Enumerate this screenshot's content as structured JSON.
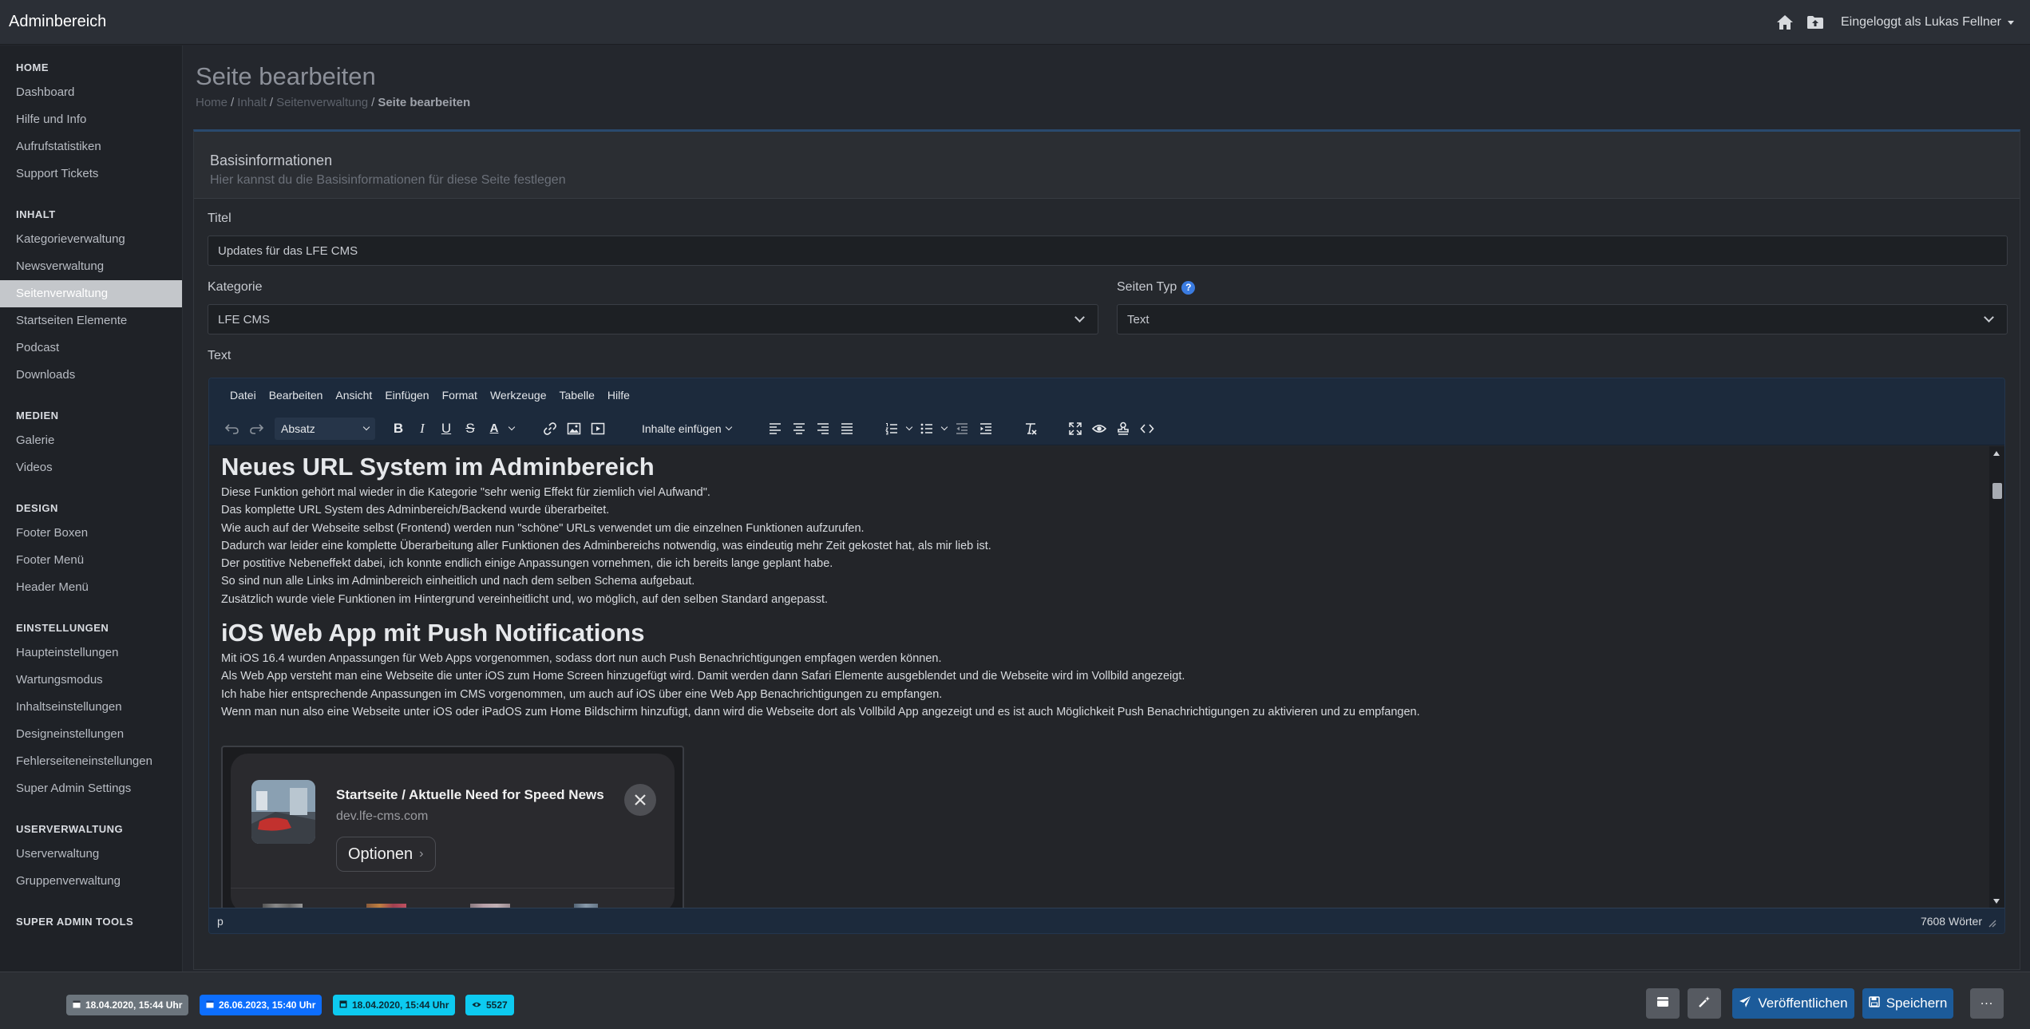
{
  "app": {
    "title": "Adminbereich"
  },
  "topbar": {
    "user_label": "Eingeloggt als Lukas Fellner"
  },
  "sidebar": {
    "sections": [
      {
        "heading": "HOME",
        "items": [
          "Dashboard",
          "Hilfe und Info",
          "Aufrufstatistiken",
          "Support Tickets"
        ]
      },
      {
        "heading": "INHALT",
        "items": [
          "Kategorieverwaltung",
          "Newsverwaltung",
          "Seitenverwaltung",
          "Startseiten Elemente",
          "Podcast",
          "Downloads"
        ]
      },
      {
        "heading": "MEDIEN",
        "items": [
          "Galerie",
          "Videos"
        ]
      },
      {
        "heading": "DESIGN",
        "items": [
          "Footer Boxen",
          "Footer Menü",
          "Header Menü"
        ]
      },
      {
        "heading": "EINSTELLUNGEN",
        "items": [
          "Haupteinstellungen",
          "Wartungsmodus",
          "Inhaltseinstellungen",
          "Designeinstellungen",
          "Fehlerseiteneinstellungen",
          "Super Admin Settings"
        ]
      },
      {
        "heading": "USERVERWALTUNG",
        "items": [
          "Userverwaltung",
          "Gruppenverwaltung"
        ]
      },
      {
        "heading": "SUPER ADMIN TOOLS",
        "items": []
      }
    ],
    "active_item": "Seitenverwaltung"
  },
  "page": {
    "title": "Seite bearbeiten",
    "breadcrumb": [
      "Home",
      "Inhalt",
      "Seitenverwaltung",
      "Seite bearbeiten"
    ]
  },
  "card": {
    "title": "Basisinformationen",
    "subtitle": "Hier kannst du die Basisinformationen für diese Seite festlegen"
  },
  "form": {
    "title_label": "Titel",
    "title_value": "Updates für das LFE CMS",
    "category_label": "Kategorie",
    "category_value": "LFE CMS",
    "type_label": "Seiten Typ",
    "type_help": "?",
    "type_value": "Text",
    "text_label": "Text"
  },
  "editor": {
    "menu": [
      "Datei",
      "Bearbeiten",
      "Ansicht",
      "Einfügen",
      "Format",
      "Werkzeuge",
      "Tabelle",
      "Hilfe"
    ],
    "block_format": "Absatz",
    "insert_content": "Inhalte einfügen",
    "content": {
      "heading1": "Neues URL System im Adminbereich",
      "paragraphs1": [
        "Diese Funktion gehört mal wieder in die Kategorie \"sehr wenig Effekt für ziemlich viel Aufwand\".",
        "Das komplette URL System des Adminbereich/Backend wurde überarbeitet.",
        "Wie auch auf der Webseite selbst (Frontend) werden nun \"schöne\" URLs verwendet um die einzelnen Funktionen aufzurufen.",
        "Dadurch war leider eine komplette Überarbeitung aller Funktionen des Adminbereichs notwendig, was eindeutig mehr Zeit gekostet hat, als mir lieb ist.",
        "Der postitive Nebeneffekt dabei, ich konnte endlich einige Anpassungen vornehmen, die ich bereits lange geplant habe.",
        "So sind nun alle Links im Adminbereich einheitlich und nach dem selben Schema aufgebaut.",
        "Zusätzlich wurde viele Funktionen im Hintergrund vereinheitlicht und, wo möglich, auf den selben Standard angepasst."
      ],
      "heading2": "iOS Web App mit Push Notifications",
      "paragraphs2": [
        "Mit iOS 16.4 wurden Anpassungen für Web Apps vorgenommen, sodass dort nun auch Push Benachrichtigungen empfagen werden können.",
        "Als Web App versteht man eine Webseite die unter iOS zum Home Screen hinzugefügt wird. Damit werden dann Safari Elemente ausgeblendet und die Webseite wird im Vollbild angezeigt.",
        "Ich habe hier entsprechende Anpassungen im CMS vorgenommen, um auch auf iOS über eine Web App Benachrichtigungen zu empfangen.",
        "Wenn man nun also eine Webseite unter iOS oder iPadOS zum Home Bildschirm hinzufügt, dann wird die Webseite dort als Vollbild App angezeigt und es ist auch Möglichkeit Push Benachrichtigungen zu aktivieren und zu empfangen."
      ],
      "notification": {
        "title": "Startseite / Aktuelle Need for Speed News",
        "url": "dev.lfe-cms.com",
        "button": "Optionen"
      }
    },
    "status_path": "p",
    "word_count": "7608 Wörter"
  },
  "footer": {
    "badges": [
      {
        "text": "18.04.2020, 15:44 Uhr",
        "color": "#6c757d"
      },
      {
        "text": "26.06.2023, 15:40 Uhr",
        "color": "#0d6efd"
      },
      {
        "text": "18.04.2020, 15:44 Uhr",
        "color": "#0dcaf0"
      },
      {
        "text": "5527",
        "color": "#0dcaf0"
      }
    ],
    "publish_label": "Veröffentlichen",
    "save_label": "Speichern",
    "more_label": "..."
  },
  "colors": {
    "accent_blue": "#1a6fc7",
    "info_cyan": "#0dcaf0",
    "primary": "#0d6efd",
    "secondary": "#6c757d"
  }
}
